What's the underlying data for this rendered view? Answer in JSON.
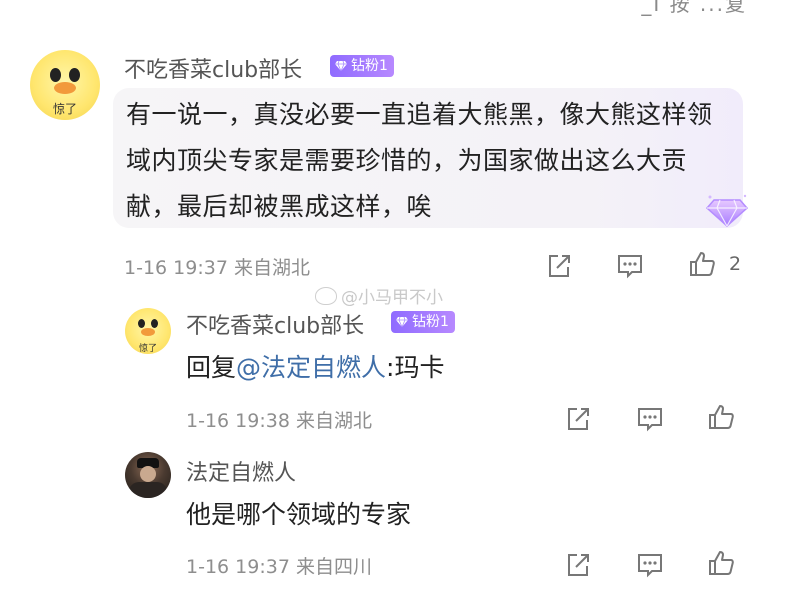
{
  "top_cut_text": "_I 按 ...复",
  "comment": {
    "username": "不吃香菜club部长",
    "badge": "钻粉1",
    "avatar_caption": "惊了",
    "text": "有一说一，真没必要一直追着大熊黑，像大熊这样领域内顶尖专家是需要珍惜的，为国家做出这么大贡献，最后却被黑成这样，唉",
    "meta": "1-16 19:37 来自湖北",
    "like_count": "2"
  },
  "watermark": "@小马甲不小",
  "replies": [
    {
      "username": "不吃香菜club部长",
      "badge": "钻粉1",
      "avatar_caption": "惊了",
      "prefix": "回复",
      "mention": "@法定自燃人",
      "text": ":玛卡",
      "meta": "1-16 19:38 来自湖北"
    },
    {
      "username": "法定自燃人",
      "text": "他是哪个领域的专家",
      "meta": "1-16 19:37 来自四川"
    }
  ],
  "icons": {
    "share": "share-icon",
    "comment": "comment-icon",
    "like": "thumbs-up-icon",
    "gem": "diamond-icon"
  },
  "colors": {
    "badge": "#9b74ff",
    "mention": "#3f6ea8",
    "meta": "#8e8e8e"
  }
}
